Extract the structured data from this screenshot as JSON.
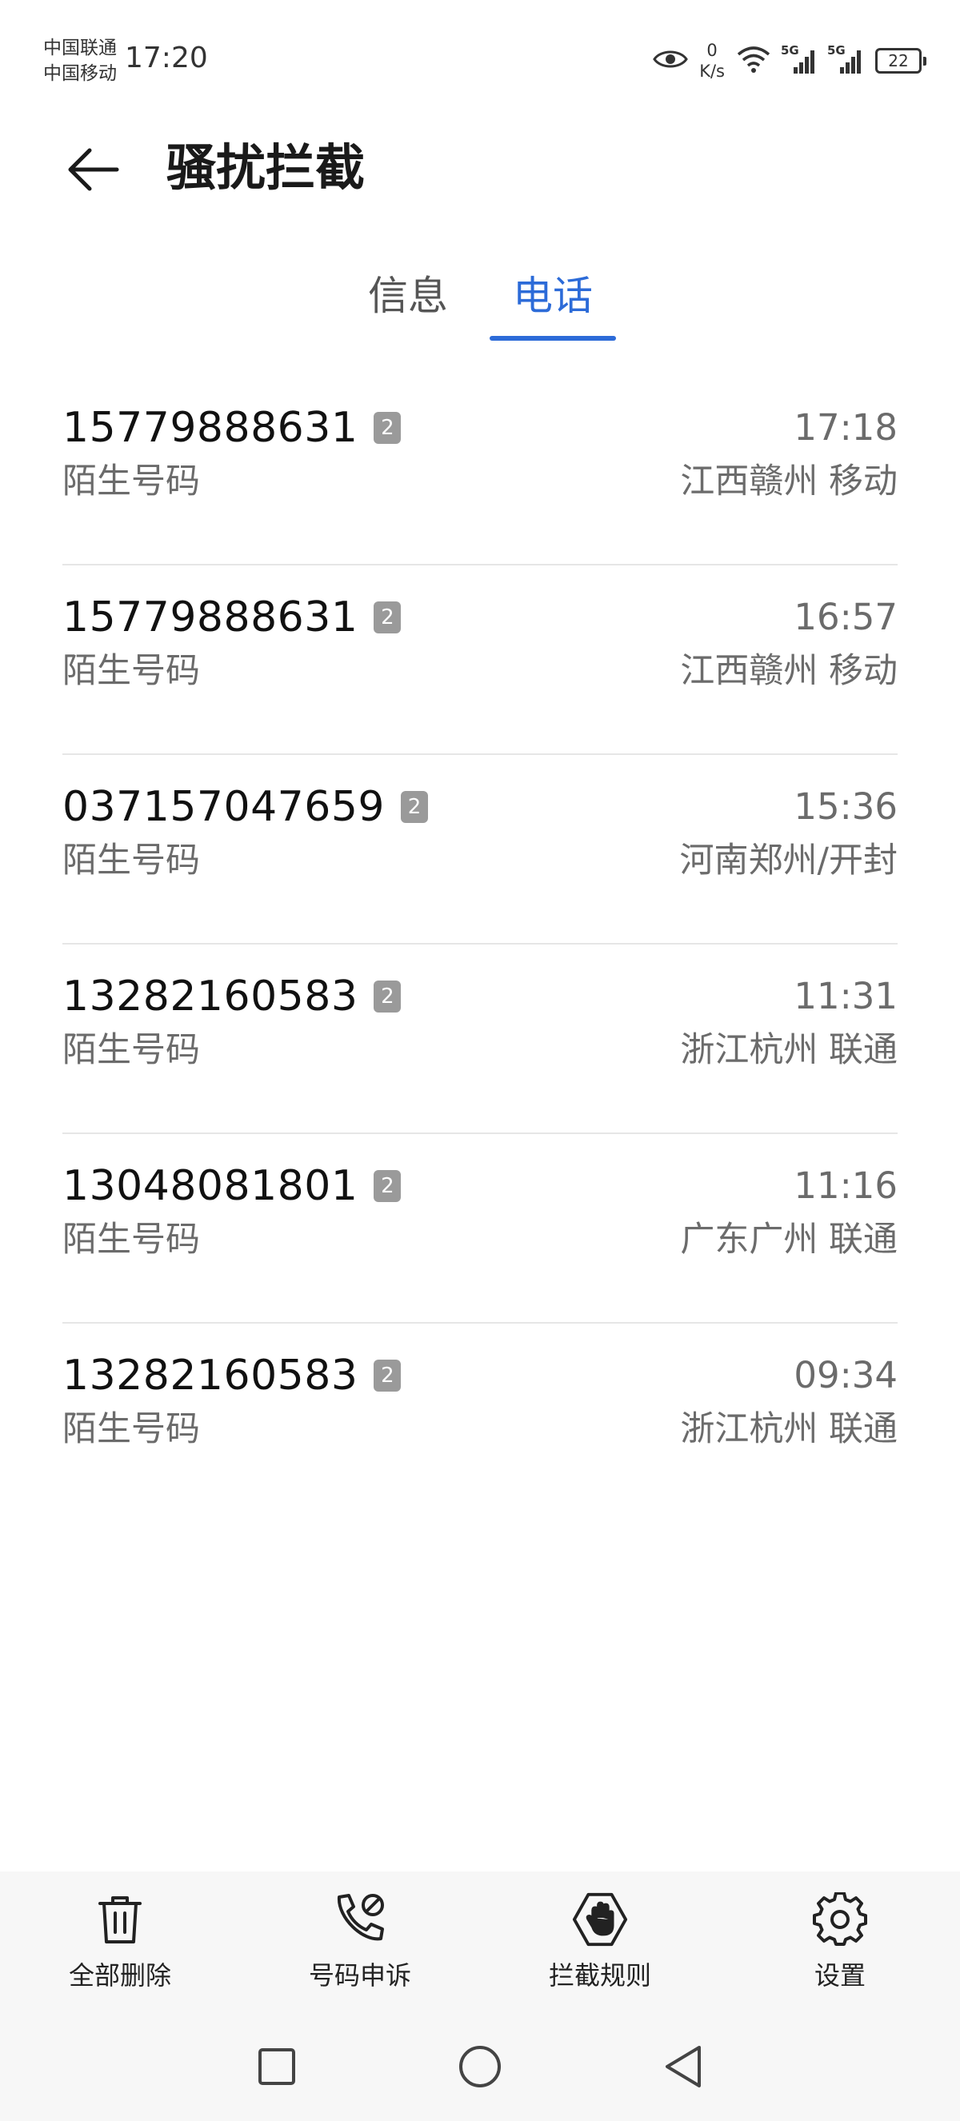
{
  "status_bar": {
    "carrier_1": "中国联通",
    "carrier_2": "中国移动",
    "time": "17:20",
    "net_speed_value": "0",
    "net_speed_unit": "K/s",
    "signal_1_tag": "5G",
    "signal_2_tag": "5G",
    "battery": "22"
  },
  "header": {
    "title": "骚扰拦截"
  },
  "tabs": {
    "info": "信息",
    "phone": "电话",
    "active": "phone",
    "accent_color": "#2c6bd8"
  },
  "calls": [
    {
      "number": "15779888631",
      "count": "2",
      "label": "陌生号码",
      "time": "17:18",
      "location": "江西赣州 移动"
    },
    {
      "number": "15779888631",
      "count": "2",
      "label": "陌生号码",
      "time": "16:57",
      "location": "江西赣州 移动"
    },
    {
      "number": "037157047659",
      "count": "2",
      "label": "陌生号码",
      "time": "15:36",
      "location": "河南郑州/开封"
    },
    {
      "number": "13282160583",
      "count": "2",
      "label": "陌生号码",
      "time": "11:31",
      "location": "浙江杭州 联通"
    },
    {
      "number": "13048081801",
      "count": "2",
      "label": "陌生号码",
      "time": "11:16",
      "location": "广东广州 联通"
    },
    {
      "number": "13282160583",
      "count": "2",
      "label": "陌生号码",
      "time": "09:34",
      "location": "浙江杭州 联通"
    }
  ],
  "toolbar": {
    "delete_all": {
      "label": "全部删除",
      "icon": "trash-icon"
    },
    "appeal": {
      "label": "号码申诉",
      "icon": "phone-appeal-icon"
    },
    "rules": {
      "label": "拦截规则",
      "icon": "hand-block-icon"
    },
    "settings": {
      "label": "设置",
      "icon": "gear-icon"
    }
  },
  "nav_bar": {
    "recents": "square-icon",
    "home": "circle-icon",
    "back": "triangle-back-icon"
  }
}
